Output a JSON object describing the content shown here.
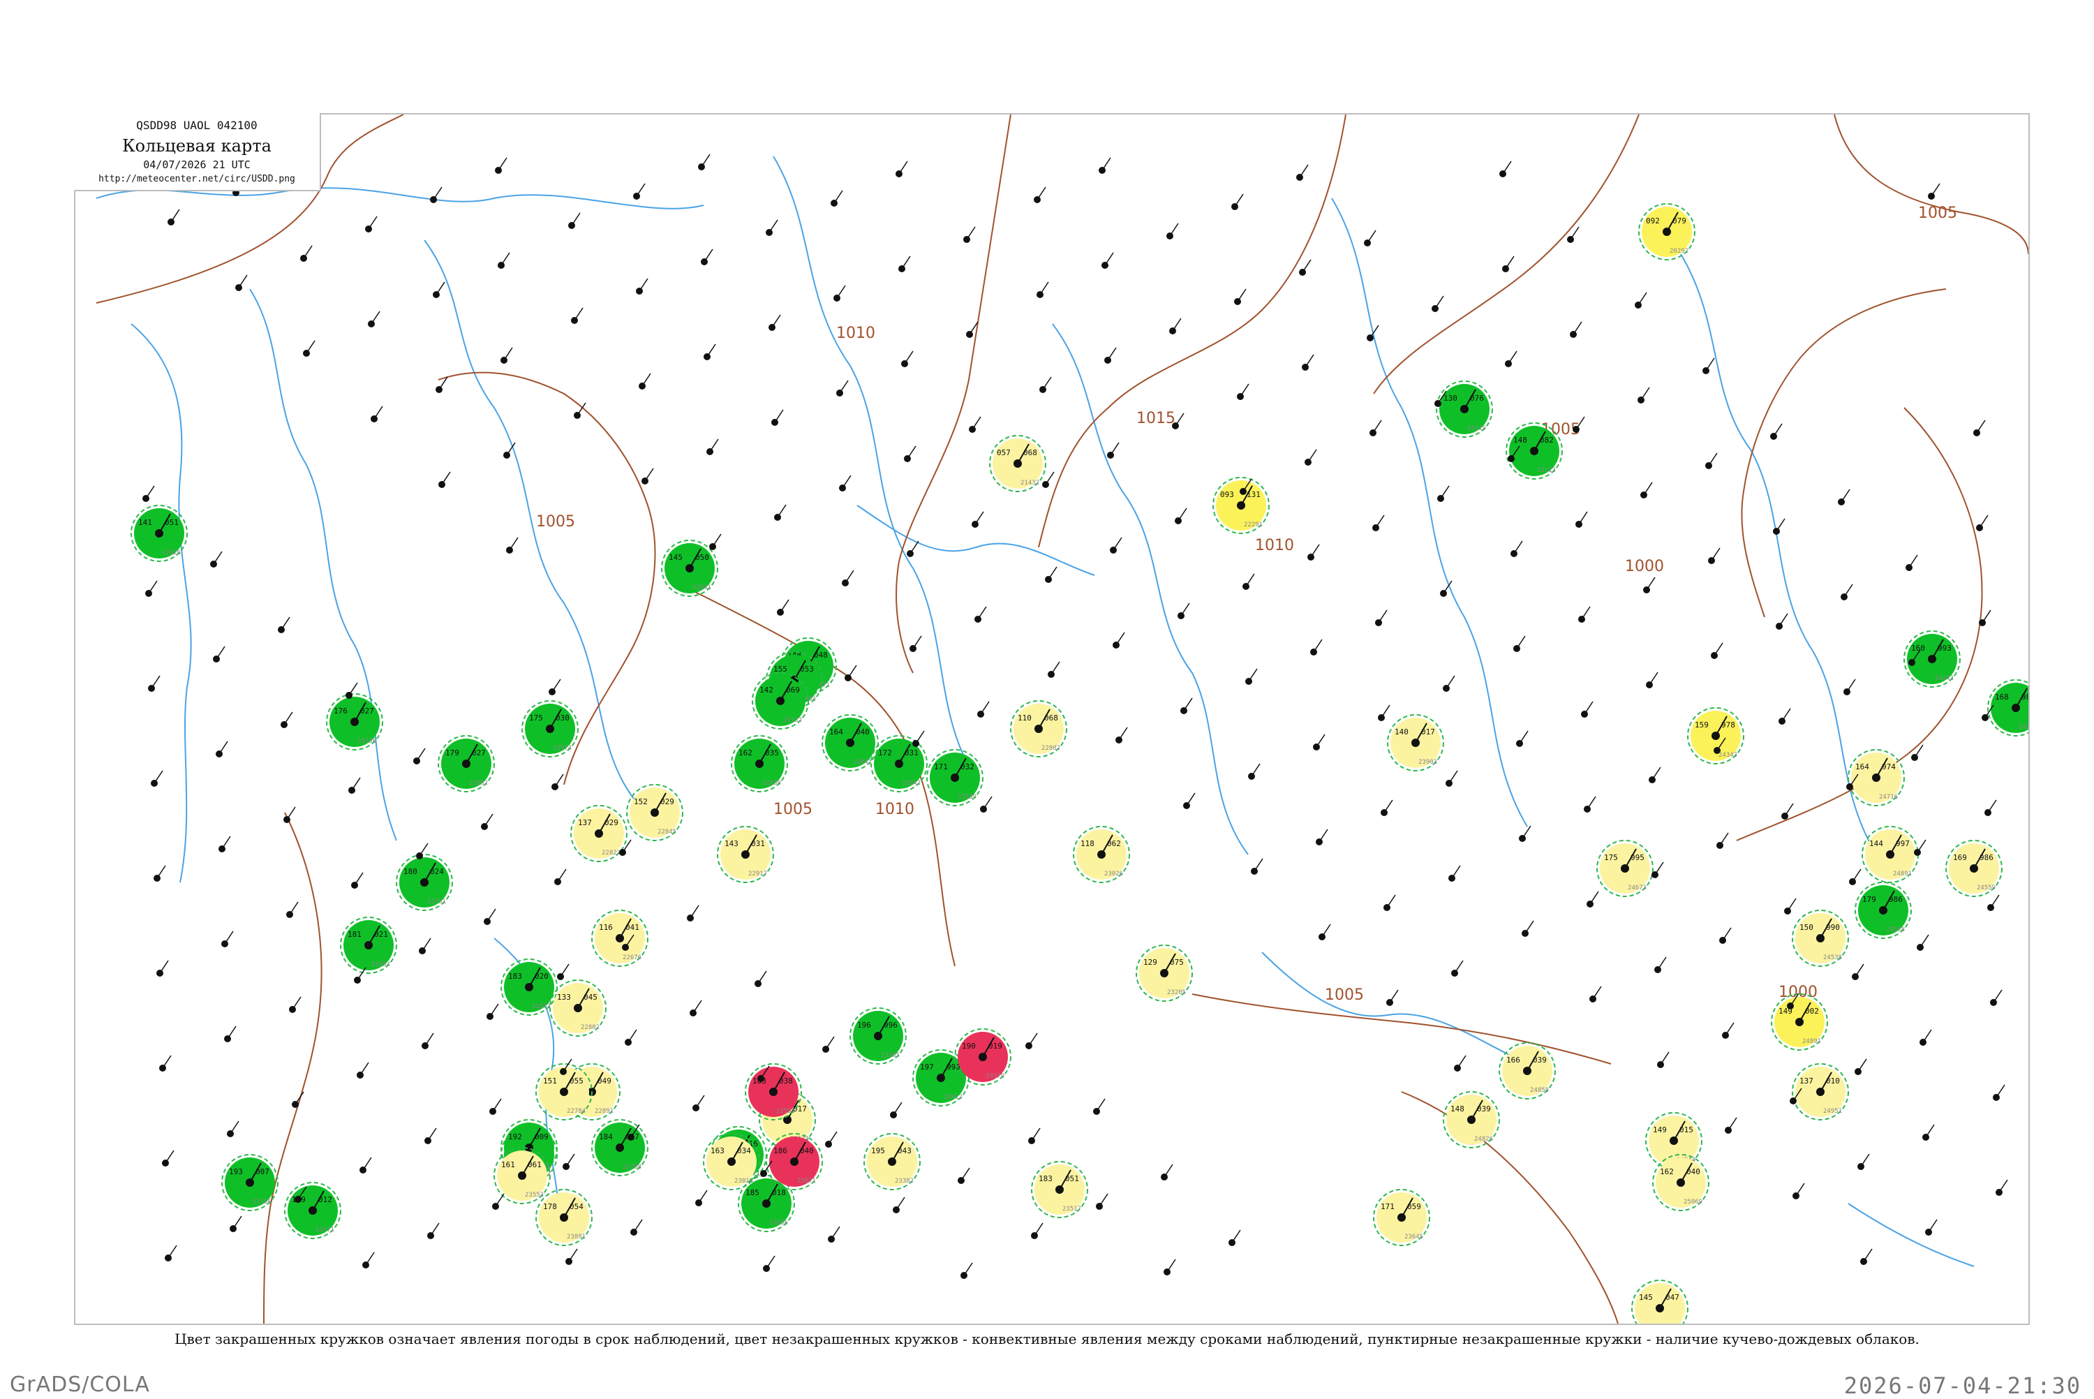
{
  "title_block": {
    "code": "QSDD98  UAOL  042100",
    "title": "Кольцевая карта",
    "date": "04/07/2026 21 UTC",
    "url": "http://meteocenter.net/circ/USDD.png"
  },
  "caption": "Цвет закрашенных кружков означает явления погоды в срок наблюдений, цвет незакрашенных кружков - конвективные явления между сроками наблюдений, пунктирные незакрашенные кружки - наличие кучево-дождевых облаков.",
  "footer": {
    "left": "GrADS/COLA",
    "right": "2026-07-04-21:30"
  },
  "colors": {
    "green": "#0fbf27",
    "yellow": "#fbf25a",
    "light_yellow": "#fcf3a1",
    "red": "#e8325a",
    "isobar": "#a0522d",
    "water": "#4aa3e6",
    "dashed_green": "#2eb84a",
    "magenta_ring": "#d0306a"
  },
  "isobar_labels": [
    {
      "text": "1005"
    },
    {
      "text": "1010"
    },
    {
      "text": "1015"
    },
    {
      "text": "1010"
    },
    {
      "text": "1005"
    },
    {
      "text": "1005"
    },
    {
      "text": "1005"
    },
    {
      "text": "1000"
    },
    {
      "text": "1005"
    },
    {
      "text": "1000"
    },
    {
      "text": "1005"
    },
    {
      "text": "1010"
    }
  ],
  "stations": [
    {
      "type": "green",
      "p": "076",
      "t": "130",
      "i": "23219"
    },
    {
      "type": "green",
      "p": "082",
      "t": "148",
      "i": "22113"
    },
    {
      "type": "green",
      "p": "051",
      "t": "141",
      "i": "22426"
    },
    {
      "type": "green",
      "p": "050",
      "t": "145",
      "i": "22641"
    },
    {
      "type": "green",
      "p": "048",
      "t": "148",
      "i": "22471"
    },
    {
      "type": "green",
      "p": "053",
      "t": "155",
      "i": "22954"
    },
    {
      "type": "green",
      "p": "069",
      "t": "142",
      "i": "23132"
    },
    {
      "type": "green",
      "p": "035",
      "t": "162",
      "i": "22830"
    },
    {
      "type": "green",
      "p": "040",
      "t": "164",
      "i": "22841"
    },
    {
      "type": "green",
      "p": "032",
      "t": "171",
      "i": "22559"
    },
    {
      "type": "green",
      "p": "031",
      "t": "172",
      "i": "22642"
    },
    {
      "type": "green",
      "p": "030",
      "t": "175",
      "i": "22974"
    },
    {
      "type": "green",
      "p": "027",
      "t": "176",
      "i": "23236"
    },
    {
      "type": "green",
      "p": "027",
      "t": "179",
      "i": "22992"
    },
    {
      "type": "green",
      "p": "024",
      "t": "180",
      "i": "22751"
    },
    {
      "type": "green",
      "p": "021",
      "t": "181",
      "i": "22854"
    },
    {
      "type": "green",
      "p": "020",
      "t": "183",
      "i": "22573"
    },
    {
      "type": "green",
      "p": "018",
      "t": "185",
      "i": "22656"
    },
    {
      "type": "green",
      "p": "016",
      "t": "187",
      "i": "22771"
    },
    {
      "type": "green",
      "p": "017",
      "t": "184",
      "i": "22788"
    },
    {
      "type": "green",
      "p": "011",
      "t": "190",
      "i": "22762"
    },
    {
      "type": "green",
      "p": "009",
      "t": "192",
      "i": "22945"
    },
    {
      "type": "green",
      "p": "007",
      "t": "193",
      "i": "23156"
    },
    {
      "type": "green",
      "p": "012",
      "t": "189",
      "i": "23271"
    },
    {
      "type": "green",
      "p": "996",
      "t": "196",
      "i": "23365"
    },
    {
      "type": "green",
      "p": "990",
      "t": "197",
      "i": "23412"
    },
    {
      "type": "green",
      "p": "993",
      "t": "160",
      "i": "24143"
    },
    {
      "type": "green",
      "p": "988",
      "t": "168",
      "i": "24261"
    },
    {
      "type": "green",
      "p": "986",
      "t": "179",
      "i": "24538"
    },
    {
      "type": "yellow",
      "p": "131",
      "t": "093",
      "i": "22291"
    },
    {
      "type": "yellow",
      "p": "079",
      "t": "092",
      "i": "20292"
    },
    {
      "type": "yellow",
      "p": "978",
      "t": "159",
      "i": "24343"
    },
    {
      "type": "yellow",
      "p": "002",
      "t": "149",
      "i": "24891"
    },
    {
      "type": "light_yellow",
      "p": "068",
      "t": "057",
      "i": "21432"
    },
    {
      "type": "light_yellow",
      "p": "068",
      "t": "110",
      "i": "22802"
    },
    {
      "type": "light_yellow",
      "p": "062",
      "t": "118",
      "i": "23026"
    },
    {
      "type": "light_yellow",
      "p": "075",
      "t": "129",
      "i": "23205"
    },
    {
      "type": "light_yellow",
      "p": "029",
      "t": "137",
      "i": "22823"
    },
    {
      "type": "light_yellow",
      "p": "029",
      "t": "152",
      "i": "22845"
    },
    {
      "type": "light_yellow",
      "p": "031",
      "t": "143",
      "i": "22917"
    },
    {
      "type": "light_yellow",
      "p": "041",
      "t": "116",
      "i": "22676"
    },
    {
      "type": "light_yellow",
      "p": "045",
      "t": "133",
      "i": "22802"
    },
    {
      "type": "light_yellow",
      "p": "049",
      "t": "162",
      "i": "22891"
    },
    {
      "type": "light_yellow",
      "p": "055",
      "t": "151",
      "i": "22784"
    },
    {
      "type": "light_yellow",
      "p": "034",
      "t": "163",
      "i": "23018"
    },
    {
      "type": "light_yellow",
      "p": "017",
      "t": "177",
      "i": "23174"
    },
    {
      "type": "light_yellow",
      "p": "043",
      "t": "195",
      "i": "23382"
    },
    {
      "type": "light_yellow",
      "p": "051",
      "t": "183",
      "i": "23517"
    },
    {
      "type": "light_yellow",
      "p": "059",
      "t": "171",
      "i": "23645"
    },
    {
      "type": "light_yellow",
      "p": "061",
      "t": "161",
      "i": "23553"
    },
    {
      "type": "light_yellow",
      "p": "054",
      "t": "178",
      "i": "23891"
    },
    {
      "type": "light_yellow",
      "p": "017",
      "t": "140",
      "i": "23903"
    },
    {
      "type": "light_yellow",
      "p": "995",
      "t": "175",
      "i": "24673"
    },
    {
      "type": "light_yellow",
      "p": "974",
      "t": "164",
      "i": "24716"
    },
    {
      "type": "light_yellow",
      "p": "997",
      "t": "144",
      "i": "24891"
    },
    {
      "type": "light_yellow",
      "p": "990",
      "t": "150",
      "i": "24538"
    },
    {
      "type": "light_yellow",
      "p": "986",
      "t": "169",
      "i": "24559"
    },
    {
      "type": "light_yellow",
      "p": "015",
      "t": "149",
      "i": "24944"
    },
    {
      "type": "light_yellow",
      "p": "010",
      "t": "137",
      "i": "24951"
    },
    {
      "type": "light_yellow",
      "p": "039",
      "t": "166",
      "i": "24858"
    },
    {
      "type": "light_yellow",
      "p": "039",
      "t": "148",
      "i": "24826"
    },
    {
      "type": "light_yellow",
      "p": "040",
      "t": "162",
      "i": "25069"
    },
    {
      "type": "light_yellow",
      "p": "047",
      "t": "145",
      "i": "25216"
    },
    {
      "type": "red",
      "p": "019",
      "t": "190",
      "i": "23379"
    },
    {
      "type": "red",
      "p": "038",
      "t": "183",
      "i": "23554"
    },
    {
      "type": "red",
      "p": "040",
      "t": "186",
      "i": "23671"
    }
  ]
}
